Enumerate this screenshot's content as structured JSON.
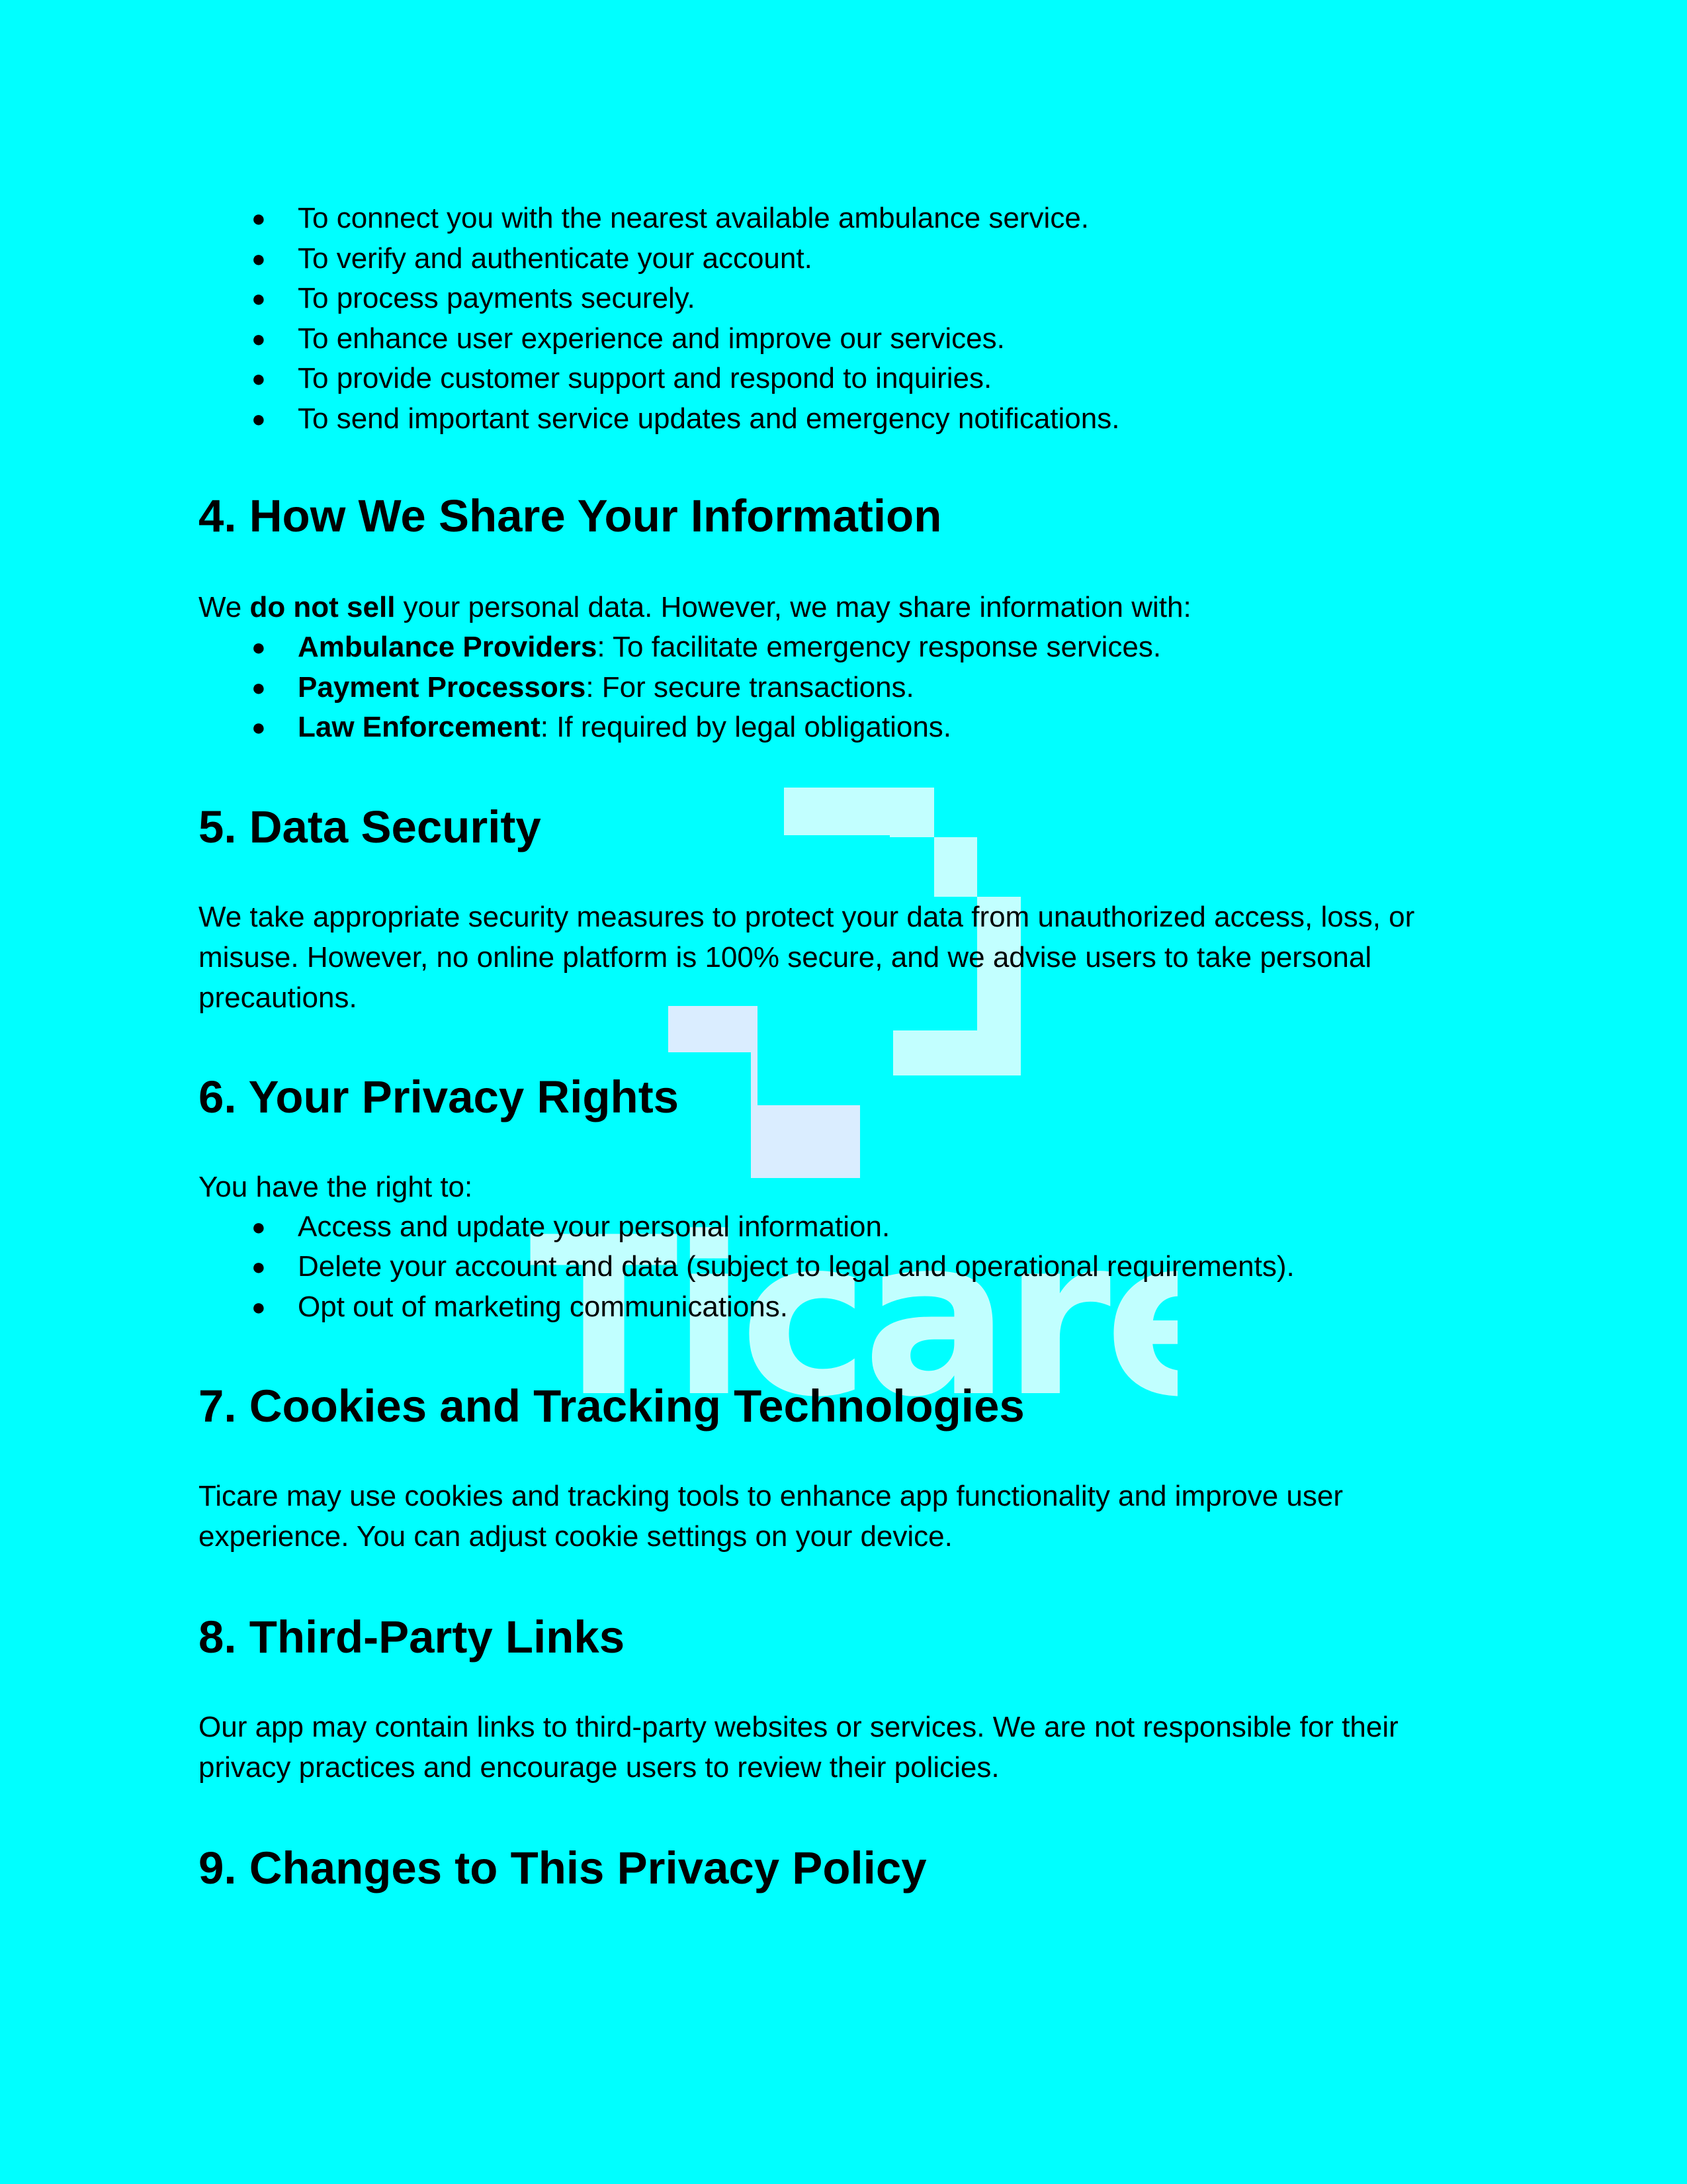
{
  "intro_list": [
    "To connect you with the nearest available ambulance service.",
    "To verify and authenticate your account.",
    "To process payments securely.",
    "To enhance user experience and improve our services.",
    "To provide customer support and respond to inquiries.",
    "To send important service updates and emergency notifications."
  ],
  "section4": {
    "heading": "4. How We Share Your Information",
    "intro_pre": "We ",
    "intro_bold": "do not sell",
    "intro_post": " your personal data. However, we may share information with:",
    "items": [
      {
        "term": "Ambulance Providers",
        "desc": ": To facilitate emergency response services."
      },
      {
        "term": "Payment Processors",
        "desc": ": For secure transactions."
      },
      {
        "term": "Law Enforcement",
        "desc": ": If required by legal obligations."
      }
    ]
  },
  "section5": {
    "heading": "5. Data Security",
    "body_line1": "We take appropriate security measures to protect your data from unauthorized access, loss, or",
    "body_line2": "misuse. However, no online platform is 100% secure, and we advise users to take personal",
    "body_line3": "precautions."
  },
  "section6": {
    "heading": "6. Your Privacy Rights",
    "intro": "You have the right to:",
    "items": [
      "Access and update your personal information.",
      "Delete your account and data (subject to legal and operational requirements).",
      "Opt out of marketing communications."
    ]
  },
  "section7": {
    "heading": "7. Cookies and Tracking Technologies",
    "body_line1": "Ticare may use cookies and tracking tools to enhance app functionality and improve user",
    "body_line2": "experience. You can adjust cookie settings on your device."
  },
  "section8": {
    "heading": "8. Third-Party Links",
    "body_line1": "Our app may contain links to third-party websites or services. We are not responsible for their",
    "body_line2": "privacy practices and encourage users to review their policies."
  },
  "section9": {
    "heading": "9. Changes to This Privacy Policy"
  },
  "bullet_glyph": "●",
  "watermark": {
    "text": "Ticare",
    "icon": "ticare-logo-icon"
  },
  "colors": {
    "background": "#00ffff",
    "text": "#000000",
    "watermark_light": "#ccffff",
    "watermark_lavender": "#e6ecff"
  }
}
